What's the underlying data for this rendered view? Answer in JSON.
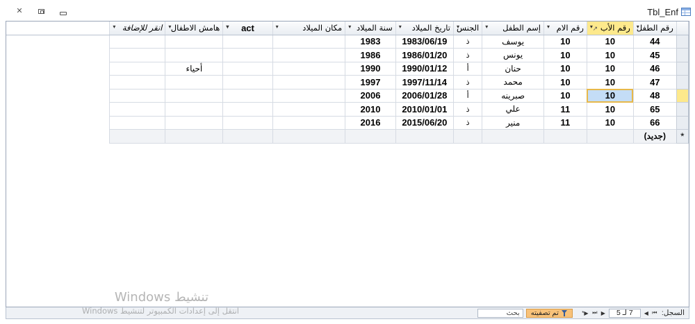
{
  "window": {
    "tab_title": "Tbl_Enf",
    "controls": {
      "close": "✕",
      "restore": "restore",
      "minimize": "minimize"
    }
  },
  "columns": [
    {
      "label": "رقم الطفل",
      "arrow": "▾"
    },
    {
      "label": "رقم الأب",
      "arrow": "▾",
      "sort_icon": "↗"
    },
    {
      "label": "رقم الام",
      "arrow": "▾"
    },
    {
      "label": "إسم الطفل",
      "arrow": "▾"
    },
    {
      "label": "الجنس",
      "arrow": "▾"
    },
    {
      "label": "تاريخ الميلاد",
      "arrow": "▾"
    },
    {
      "label": "سنة الميلاد",
      "arrow": "▾"
    },
    {
      "label": "مكان الميلاد",
      "arrow": "▾"
    },
    {
      "label": "act",
      "arrow": "▾"
    },
    {
      "label": "هامش الاطفال",
      "arrow": "▾"
    },
    {
      "label": "انقر للإضافة",
      "arrow": "▾"
    }
  ],
  "rows": [
    {
      "child_id": "44",
      "father_id": "10",
      "mother_id": "10",
      "name": "يوسف",
      "sex": "ذ",
      "birth_date": "1983/06/19",
      "birth_year": "1983",
      "birth_place": "",
      "act": "",
      "note": ""
    },
    {
      "child_id": "45",
      "father_id": "10",
      "mother_id": "10",
      "name": "يونس",
      "sex": "ذ",
      "birth_date": "1986/01/20",
      "birth_year": "1986",
      "birth_place": "",
      "act": "",
      "note": ""
    },
    {
      "child_id": "46",
      "father_id": "10",
      "mother_id": "10",
      "name": "حنان",
      "sex": "أ",
      "birth_date": "1990/01/12",
      "birth_year": "1990",
      "birth_place": "",
      "act": "",
      "note": "أحياء"
    },
    {
      "child_id": "47",
      "father_id": "10",
      "mother_id": "10",
      "name": "محمد",
      "sex": "ذ",
      "birth_date": "1997/11/14",
      "birth_year": "1997",
      "birth_place": "",
      "act": "",
      "note": ""
    },
    {
      "child_id": "48",
      "father_id": "10",
      "mother_id": "10",
      "name": "صبرينه",
      "sex": "أ",
      "birth_date": "2006/01/28",
      "birth_year": "2006",
      "birth_place": "",
      "act": "",
      "note": ""
    },
    {
      "child_id": "65",
      "father_id": "10",
      "mother_id": "11",
      "name": "علي",
      "sex": "ذ",
      "birth_date": "2010/01/01",
      "birth_year": "2010",
      "birth_place": "",
      "act": "",
      "note": ""
    },
    {
      "child_id": "66",
      "father_id": "10",
      "mother_id": "11",
      "name": "منير",
      "sex": "ذ",
      "birth_date": "2015/06/20",
      "birth_year": "2016",
      "birth_place": "",
      "act": "",
      "note": ""
    }
  ],
  "new_row": {
    "marker": "*",
    "label": "(جديد)"
  },
  "navigation": {
    "record_label": "السجل:",
    "first": "⏮",
    "prev": "◀",
    "position": "7 لـ 5",
    "next": "▶",
    "last": "⏭",
    "new_record": "▶*",
    "filter_label": "تم تصفيته",
    "search_placeholder": "بحث"
  },
  "watermark": {
    "line1": "تنشيط Windows",
    "line2": "انتقل إلى إعدادات الكمبيوتر لتنشيط Windows"
  },
  "colors": {
    "active_header": "#fde98c",
    "focused_cell": "#c4ddf6",
    "focus_border": "#e7b84a",
    "filter_badge": "#f8c27a",
    "grid_lines": "#d6dbe3"
  }
}
